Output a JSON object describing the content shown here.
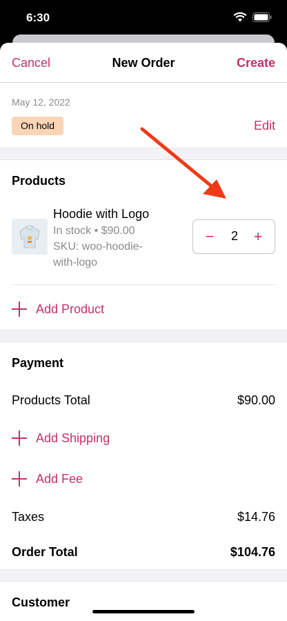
{
  "status_bar": {
    "time": "6:30"
  },
  "nav": {
    "cancel": "Cancel",
    "title": "New Order",
    "create": "Create"
  },
  "order": {
    "date": "May 12, 2022",
    "status": "On hold",
    "edit": "Edit"
  },
  "products": {
    "title": "Products",
    "items": [
      {
        "name": "Hoodie with Logo",
        "stock_price": "In stock • $90.00",
        "sku_line1": "SKU: woo-hoodie-",
        "sku_line2": "with-logo",
        "quantity": "2",
        "thumbnail": "hoodie-thumbnail"
      }
    ],
    "add_product": "Add Product"
  },
  "payment": {
    "title": "Payment",
    "products_total_label": "Products Total",
    "products_total_value": "$90.00",
    "add_shipping": "Add Shipping",
    "add_fee": "Add Fee",
    "taxes_label": "Taxes",
    "taxes_value": "$14.76",
    "order_total_label": "Order Total",
    "order_total_value": "$104.76"
  },
  "customer": {
    "title": "Customer"
  },
  "colors": {
    "accent": "#c5306a",
    "badge": "#fbd5b6",
    "annotation_arrow": "#f03a17"
  },
  "icons": [
    "wifi-icon",
    "battery-icon",
    "signal-icon",
    "minus-icon",
    "plus-icon",
    "annotation-arrow"
  ]
}
